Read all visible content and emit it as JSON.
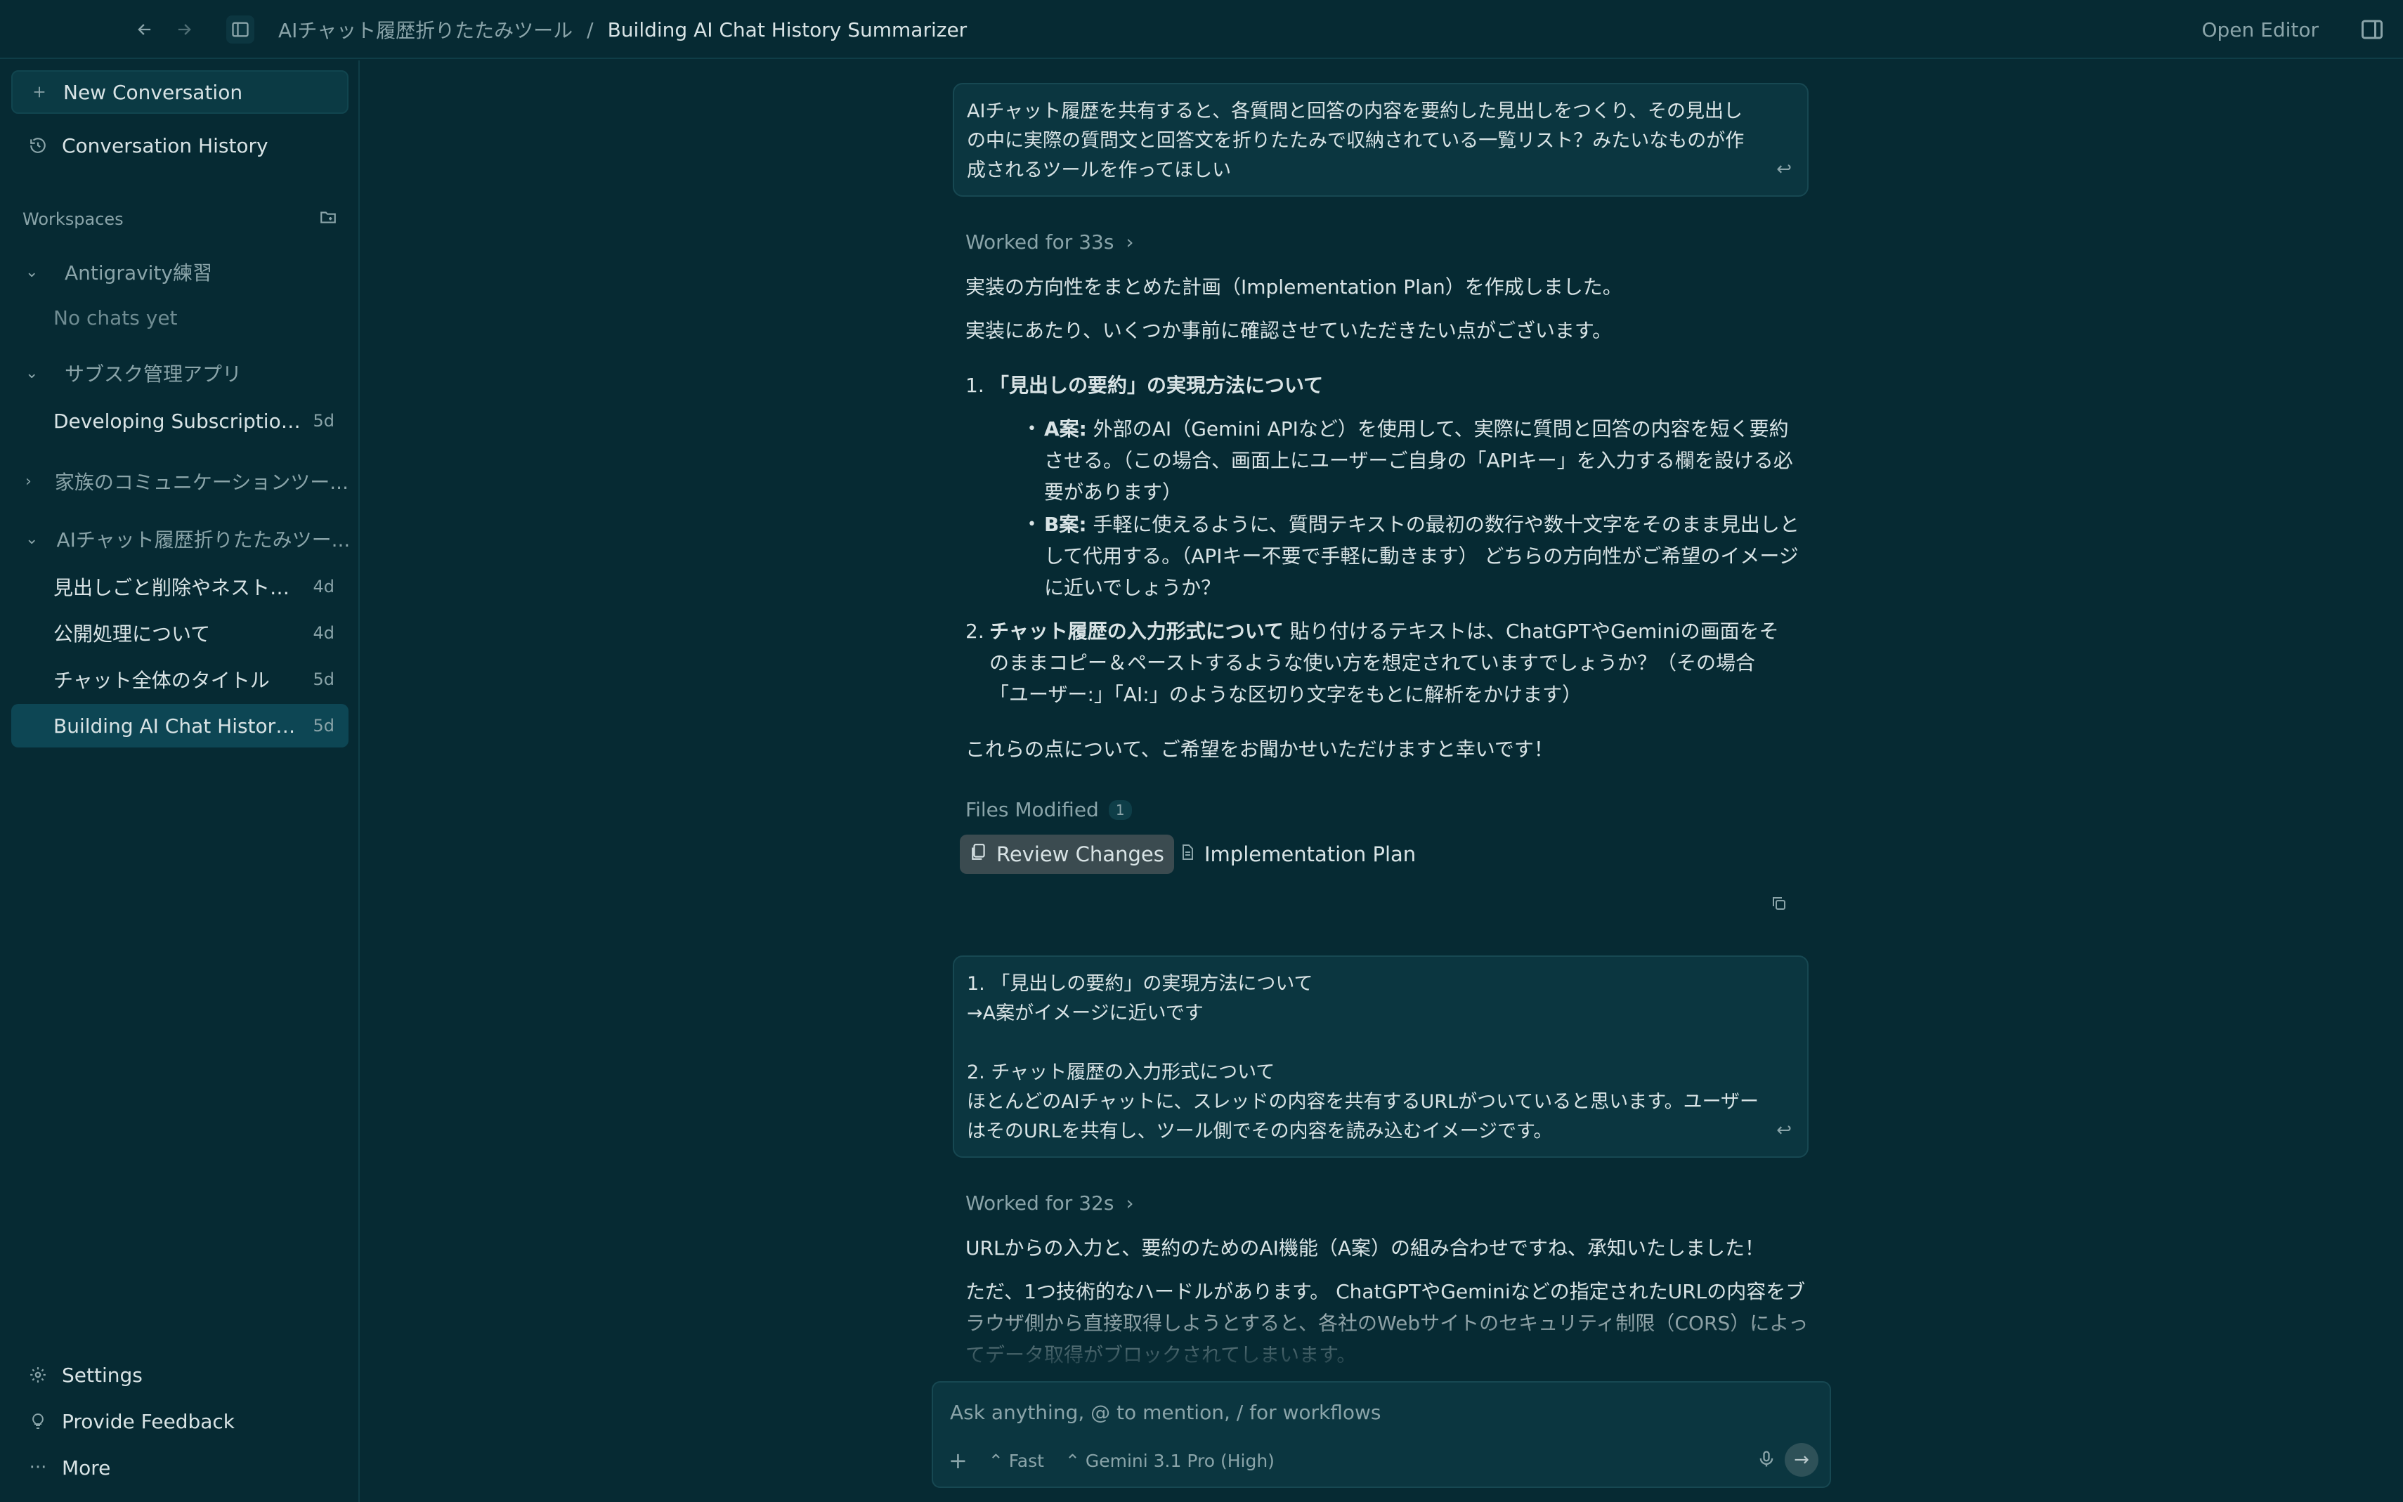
{
  "topbar": {
    "breadcrumb_parent": "AIチャット履歴折りたたみツール",
    "breadcrumb_sep": "/",
    "breadcrumb_current": "Building AI Chat History Summarizer",
    "open_editor": "Open Editor"
  },
  "sidebar": {
    "new_conversation": "New Conversation",
    "conversation_history": "Conversation History",
    "workspaces_label": "Workspaces",
    "workspaces": [
      {
        "name": "Antigravity練習",
        "expanded": true,
        "empty_note": "No chats yet"
      },
      {
        "name": "サブスク管理アプリ",
        "expanded": true,
        "chats": [
          {
            "title": "Developing Subscription ...",
            "age": "5d"
          }
        ]
      },
      {
        "name": "家族のコミュニケーションツー...",
        "expanded": false
      },
      {
        "name": "AIチャット履歴折りたたみツー...",
        "expanded": true,
        "chats": [
          {
            "title": "見出しごと削除やネストし...",
            "age": "4d"
          },
          {
            "title": "公開処理について",
            "age": "4d"
          },
          {
            "title": "チャット全体のタイトル",
            "age": "5d"
          },
          {
            "title": "Building AI Chat History S...",
            "age": "5d",
            "selected": true
          }
        ]
      }
    ],
    "settings": "Settings",
    "feedback": "Provide Feedback",
    "more": "More"
  },
  "chat": {
    "user_msg_1": "AIチャット履歴を共有すると、各質問と回答の内容を要約した見出しをつくり、その見出しの中に実際の質問文と回答文を折りたたみで収納されている一覧リスト？みたいなものが作成されるツールを作ってほしい",
    "worked_1": "Worked for 33s",
    "reply_p1": "実装の方向性をまとめた計画（Implementation Plan）を作成しました。",
    "reply_p2": "実装にあたり、いくつか事前に確認させていただきたい点がございます。",
    "item1_num": "1.",
    "item1_title": "「見出しの要約」の実現方法について",
    "bulletA_label": "A案:",
    "bulletA_text": " 外部のAI（Gemini APIなど）を使用して、実際に質問と回答の内容を短く要約させる。（この場合、画面上にユーザーご自身の「APIキー」を入力する欄を設ける必要があります）",
    "bulletB_label": "B案:",
    "bulletB_text": " 手軽に使えるように、質問テキストの最初の数行や数十文字をそのまま見出しとして代用する。（APIキー不要で手軽に動きます） どちらの方向性がご希望のイメージに近いでしょうか？",
    "item2_num": "2.",
    "item2_title": "チャット履歴の入力形式について",
    "item2_text": " 貼り付けるテキストは、ChatGPTやGeminiの画面をそのままコピー＆ペーストするような使い方を想定されていますでしょうか？（その場合「ユーザー:」「AI:」のような区切り文字をもとに解析をかけます）",
    "reply_p3": "これらの点について、ご希望をお聞かせいただけますと幸いです！",
    "files_modified": "Files Modified",
    "files_count": "1",
    "review_changes": "Review Changes",
    "implementation_plan": "Implementation Plan",
    "user_msg_2_lines": [
      "1. 「見出しの要約」の実現方法について",
      "→A案がイメージに近いです",
      "",
      "2. チャット履歴の入力形式について",
      "ほとんどのAIチャットに、スレッドの内容を共有するURLがついていると思います。ユーザーはそのURLを共有し、ツール側でその内容を読み込むイメージです。"
    ],
    "worked_2": "Worked for 32s",
    "reply2_p1": "URLからの入力と、要約のためのAI機能（A案）の組み合わせですね、承知いたしました！",
    "reply2_p2": "ただ、1つ技術的なハードルがあります。 ChatGPTやGeminiなどの指定されたURLの内容をブラウザ側から直接取得しようとすると、各社のWebサイトのセキュリティ制限（CORS）によってデータ取得がブロックされてしまいます。"
  },
  "input": {
    "placeholder": "Ask anything, @ to mention, / for workflows",
    "mode": "Fast",
    "model": "Gemini 3.1 Pro (High)"
  }
}
